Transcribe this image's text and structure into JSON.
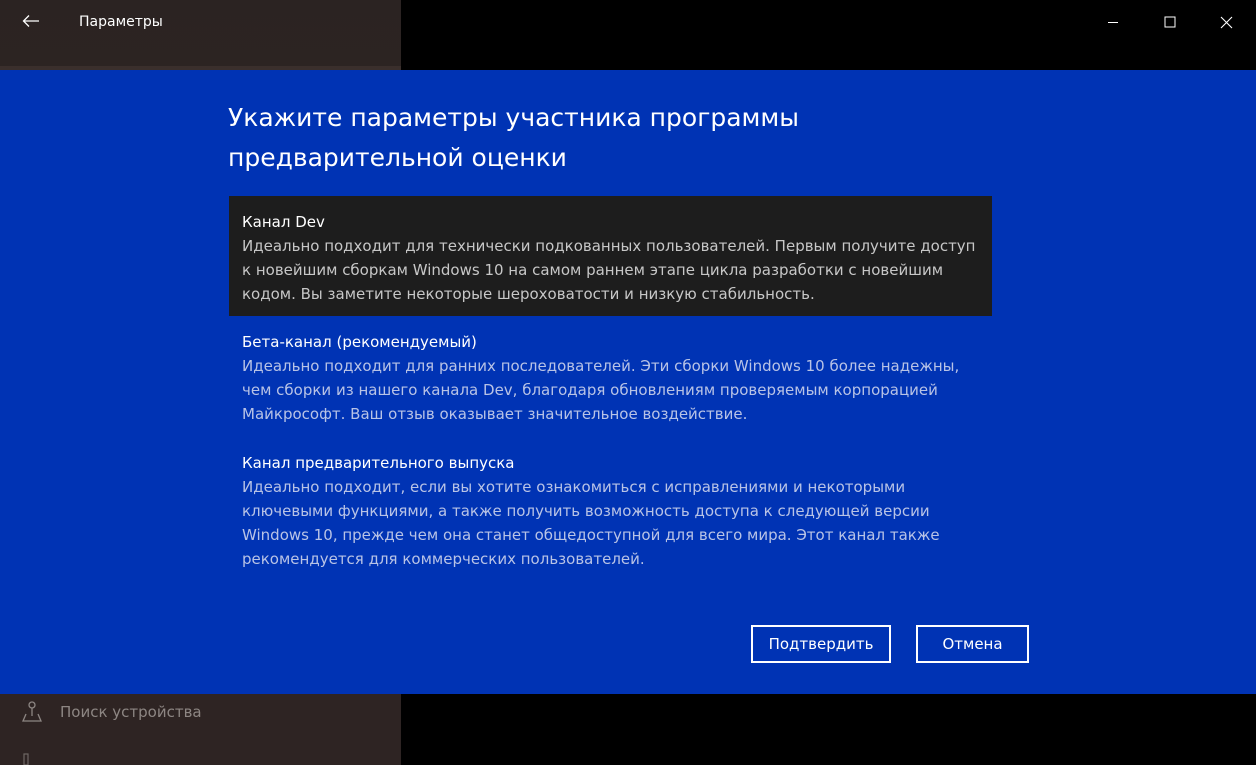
{
  "window": {
    "title": "Параметры"
  },
  "titlebar": {
    "back_icon": "arrow-left-icon",
    "minimize_icon": "minimize-icon",
    "maximize_icon": "maximize-icon",
    "close_icon": "close-icon"
  },
  "sidebar": {
    "find_device_label": "Поиск устройства",
    "find_device_icon": "location-person-icon"
  },
  "dialog": {
    "title": "Укажите параметры участника программы предварительной оценки",
    "options": [
      {
        "title": "Канал Dev",
        "description": "Идеально подходит для технически подкованных пользователей. Первым получите доступ к новейшим сборкам Windows 10 на самом раннем этапе цикла разработки с новейшим кодом. Вы заметите некоторые шероховатости и низкую стабильность.",
        "selected": true
      },
      {
        "title": "Бета-канал (рекомендуемый)",
        "description": "Идеально подходит для ранних последователей. Эти сборки Windows 10 более надежны, чем сборки из нашего канала Dev, благодаря обновлениям проверяемым корпорацией Майкрософт. Ваш отзыв оказывает значительное воздействие.",
        "selected": false
      },
      {
        "title": "Канал предварительного выпуска",
        "description": "Идеально подходит, если вы хотите ознакомиться с исправлениями и некоторыми ключевыми функциями, а также получить возможность доступа к следующей версии Windows 10, прежде чем она станет общедоступной для всего мира. Этот канал также рекомендуется для коммерческих пользователей.",
        "selected": false
      }
    ],
    "confirm_label": "Подтвердить",
    "cancel_label": "Отмена"
  },
  "colors": {
    "dialog_background": "#0033b4",
    "selected_option_background": "#1d1d1d",
    "text_primary": "#ffffff"
  }
}
